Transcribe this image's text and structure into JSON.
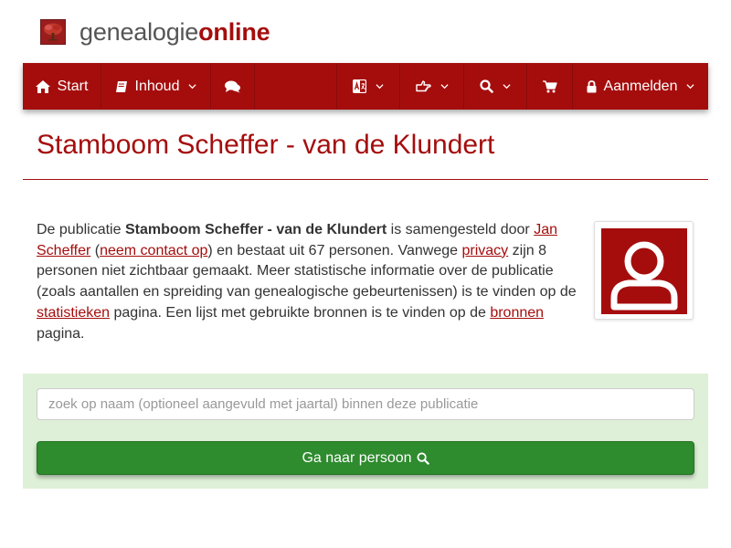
{
  "header": {
    "logo_part1": "genealogie",
    "logo_part2": "online",
    "logo_icon": "tree-icon"
  },
  "navbar": {
    "start_label": "Start",
    "inhoud_label": "Inhoud",
    "login_label": "Aanmelden",
    "icons": [
      "home-icon",
      "book-icon",
      "comments-icon",
      "language-icon",
      "hand-point-icon",
      "search-icon",
      "cart-icon",
      "lock-icon",
      "chevron-down-icon"
    ]
  },
  "page": {
    "title": "Stamboom Scheffer - van de Klundert"
  },
  "intro": {
    "t1": "De publicatie ",
    "pub_name": "Stamboom Scheffer - van de Klundert",
    "t2": " is samengesteld door ",
    "author_link": "Jan Scheffer",
    "t3": " (",
    "contact_link": "neem contact op",
    "t4": ") en bestaat uit 67 personen. Vanwege ",
    "privacy_link": "privacy",
    "t5": " zijn 8 personen niet zichtbaar gemaakt. Meer statistische informatie over de publicatie (zoals aantallen en spreiding van genealogische gebeurtenissen) is te vinden op de ",
    "stats_link": "statistieken",
    "t6": " pagina. Een lijst met gebruikte bronnen is te vinden op de ",
    "sources_link": "bronnen",
    "t7": " pagina."
  },
  "search": {
    "placeholder": "zoek op naam (optioneel aangevuld met jaartal) binnen deze publicatie",
    "value": "",
    "button_label": "Ga naar persoon"
  },
  "colors": {
    "brand": "#a50d0d",
    "panel": "#dff0d8",
    "button": "#2e8b2e"
  }
}
